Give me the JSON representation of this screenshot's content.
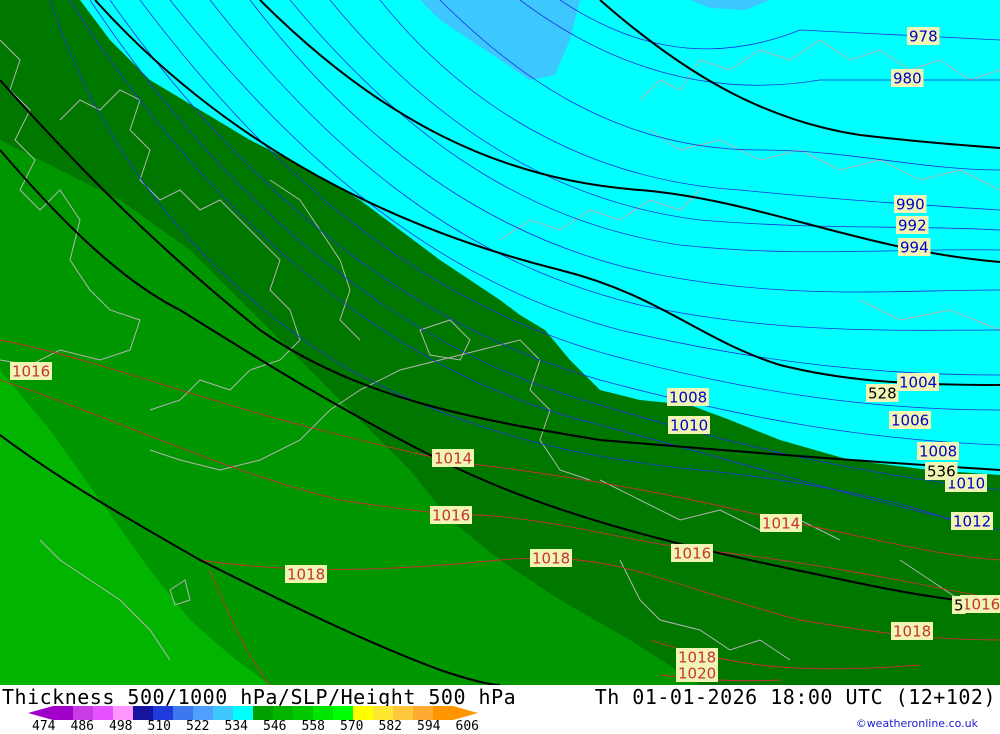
{
  "map": {
    "isobar_labels": [
      {
        "text": "978",
        "border": "#0000c8"
      },
      {
        "text": "980",
        "border": "#0000c8"
      },
      {
        "text": "990",
        "border": "#0000c8"
      },
      {
        "text": "992",
        "border": "#0000c8"
      },
      {
        "text": "994",
        "border": "#0000c8"
      },
      {
        "text": "1004",
        "border": "#0000c8"
      },
      {
        "text": "1006",
        "border": "#0000c8"
      },
      {
        "text": "1008",
        "border": "#0000c8"
      },
      {
        "text": "1008",
        "border": "#0000c8"
      },
      {
        "text": "1010",
        "border": "#0000c8"
      },
      {
        "text": "1010",
        "border": "#0000c8"
      },
      {
        "text": "1012",
        "border": "#0000c8"
      },
      {
        "text": "1014",
        "border": "#c83232"
      },
      {
        "text": "1014",
        "border": "#c83232"
      },
      {
        "text": "1016",
        "border": "#c83232"
      },
      {
        "text": "1016",
        "border": "#c83232"
      },
      {
        "text": "1016",
        "border": "#c83232"
      },
      {
        "text": "1016",
        "border": "#c83232"
      },
      {
        "text": "1018",
        "border": "#c83232"
      },
      {
        "text": "1018",
        "border": "#c83232"
      },
      {
        "text": "1018",
        "border": "#c83232"
      },
      {
        "text": "1018",
        "border": "#c83232"
      },
      {
        "text": "1020",
        "border": "#c83232"
      }
    ],
    "height_labels": [
      "528",
      "536",
      "5"
    ]
  },
  "title": {
    "left": "Thickness 500/1000 hPa/SLP/Height 500 hPa",
    "right": "Th 01-01-2026 18:00 UTC (12+102)"
  },
  "legend": {
    "ticks": [
      "474",
      "486",
      "498",
      "510",
      "522",
      "534",
      "546",
      "558",
      "570",
      "582",
      "594",
      "606"
    ],
    "colors": [
      "#a000c8",
      "#c83ce6",
      "#e650ff",
      "#ff96ff",
      "#1414a0",
      "#1e3cdc",
      "#3c78f0",
      "#50a0ff",
      "#3cc8ff",
      "#00ffff",
      "#00a000",
      "#00b400",
      "#00c800",
      "#00e600",
      "#00ff00",
      "#ffff00",
      "#ffe632",
      "#ffc83c",
      "#ffaa32",
      "#ff9600"
    ]
  },
  "credit": "©weatheronline.co.uk"
}
